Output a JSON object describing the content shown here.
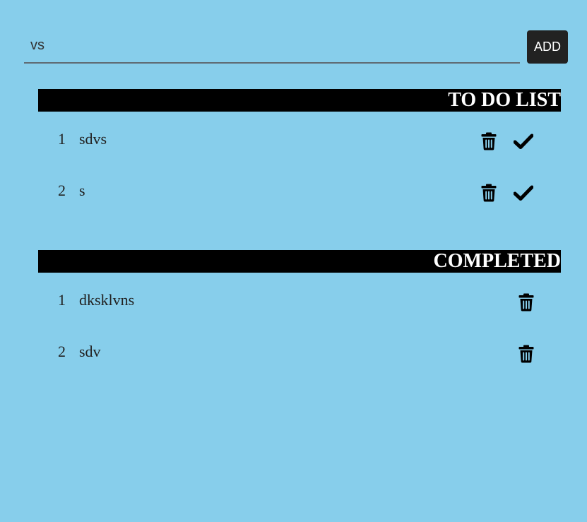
{
  "input": {
    "value": "vs",
    "placeholder": ""
  },
  "add_button_label": "ADD",
  "todo": {
    "title": "TO DO LIST",
    "items": [
      {
        "index": "1",
        "text": "sdvs"
      },
      {
        "index": "2",
        "text": "s"
      }
    ]
  },
  "completed": {
    "title": "COMPLETED",
    "items": [
      {
        "index": "1",
        "text": "dksklvns"
      },
      {
        "index": "2",
        "text": "sdv"
      }
    ]
  },
  "colors": {
    "background": "#87ceeb",
    "header_bg": "#000000",
    "header_text": "#ffffff",
    "button_bg": "#222222"
  },
  "icons": {
    "delete": "trash-icon",
    "complete": "check-icon"
  }
}
